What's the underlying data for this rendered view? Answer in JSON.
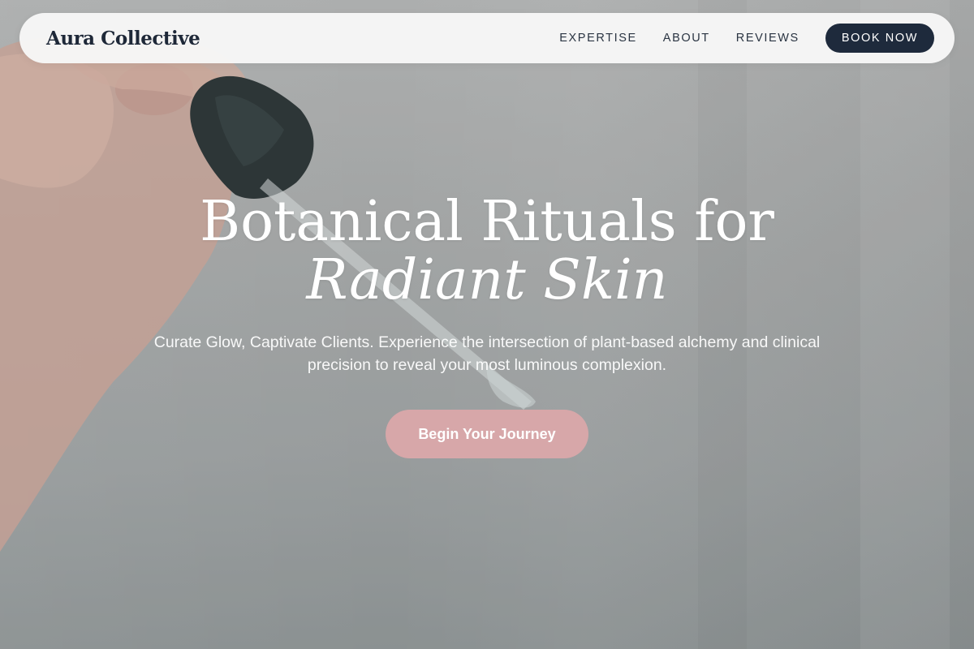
{
  "brand": {
    "name": "Aura Collective"
  },
  "nav": {
    "links": [
      {
        "label": "EXPERTISE"
      },
      {
        "label": "ABOUT"
      },
      {
        "label": "REVIEWS"
      }
    ],
    "cta_label": "BOOK NOW"
  },
  "hero": {
    "headline_line1": "Botanical Rituals for",
    "headline_line2": "Radiant Skin",
    "subtext": "Curate Glow, Captivate Clients. Experience the intersection of plant-based alchemy and clinical precision to reveal your most luminous complexion.",
    "cta_label": "Begin Your Journey"
  },
  "colors": {
    "brand_text": "#1e2838",
    "book_button_bg": "#1e2a3c",
    "cta_button_bg": "#d7a7a9",
    "navbar_bg": "#f7f7f7"
  }
}
